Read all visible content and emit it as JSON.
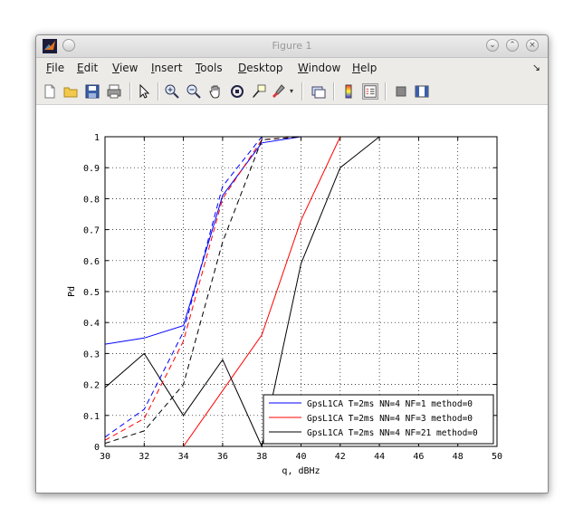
{
  "window": {
    "title": "Figure 1"
  },
  "menu": [
    {
      "label": "File",
      "u": "F",
      "rest": "ile"
    },
    {
      "label": "Edit",
      "u": "E",
      "rest": "dit"
    },
    {
      "label": "View",
      "u": "V",
      "rest": "iew"
    },
    {
      "label": "Insert",
      "u": "I",
      "rest": "nsert"
    },
    {
      "label": "Tools",
      "u": "T",
      "rest": "ools"
    },
    {
      "label": "Desktop",
      "u": "D",
      "rest": "esktop"
    },
    {
      "label": "Window",
      "u": "W",
      "rest": "indow"
    },
    {
      "label": "Help",
      "u": "H",
      "rest": "elp"
    }
  ],
  "toolbar_icons": [
    "new-figure-icon",
    "open-file-icon",
    "save-icon",
    "print-icon",
    "select-arrow-icon",
    "zoom-in-icon",
    "zoom-out-icon",
    "pan-hand-icon",
    "rotate-3d-icon",
    "data-cursor-icon",
    "brush-icon",
    "link-plot-icon",
    "insert-colorbar-icon",
    "insert-legend-icon",
    "hide-plot-tools-icon",
    "show-plot-tools-icon"
  ],
  "chart_data": {
    "type": "line",
    "xlabel": "q, dBHz",
    "ylabel": "Pd",
    "xlim": [
      30,
      50
    ],
    "ylim": [
      0,
      1
    ],
    "xticks": [
      30,
      32,
      34,
      36,
      38,
      40,
      42,
      44,
      46,
      48,
      50
    ],
    "yticks": [
      0,
      0.1,
      0.2,
      0.3,
      0.4,
      0.5,
      0.6,
      0.7,
      0.8,
      0.9,
      1
    ],
    "ytick_labels": [
      "0",
      "0.1",
      "0.2",
      "0.3",
      "0.4",
      "0.5",
      "0.6",
      "0.7",
      "0.8",
      "0.9",
      "1"
    ],
    "grid": "dotted",
    "legend_position": "bottom-right",
    "series": [
      {
        "name": "GpsL1CA T=2ms NN=4 NF=1 method=0",
        "color": "#0000ff",
        "style": "solid",
        "x": [
          30,
          32,
          34,
          36,
          38,
          40,
          42,
          44,
          46,
          48,
          50
        ],
        "y": [
          0.33,
          0.35,
          0.39,
          0.81,
          0.98,
          1,
          1,
          1,
          1,
          1,
          1
        ]
      },
      {
        "name": "GpsL1CA T=2ms NN=4 NF=3 method=0",
        "color": "#ff0000",
        "style": "solid",
        "x": [
          30,
          32,
          34,
          36,
          38,
          40,
          42,
          44,
          46,
          48,
          50
        ],
        "y": [
          0,
          0,
          0,
          0.18,
          0.36,
          0.73,
          1,
          1,
          1,
          1,
          1
        ]
      },
      {
        "name": "GpsL1CA T=2ms NN=4 NF=21 method=0",
        "color": "#000000",
        "style": "solid",
        "x": [
          30,
          32,
          34,
          36,
          38,
          40,
          42,
          44,
          46,
          48,
          50
        ],
        "y": [
          0.19,
          0.3,
          0.1,
          0.28,
          0,
          0.59,
          0.9,
          1,
          1,
          1,
          1
        ]
      },
      {
        "name": "",
        "color": "#0000ff",
        "style": "dashed",
        "x": [
          30,
          32,
          34,
          36,
          38,
          40,
          42,
          44,
          46,
          48,
          50
        ],
        "y": [
          0.03,
          0.12,
          0.37,
          0.84,
          1,
          1,
          1,
          1,
          1,
          1,
          1
        ]
      },
      {
        "name": "",
        "color": "#ff0000",
        "style": "dashed",
        "x": [
          30,
          32,
          34,
          36,
          38,
          40,
          42,
          44,
          46,
          48,
          50
        ],
        "y": [
          0.02,
          0.09,
          0.34,
          0.8,
          0.99,
          1,
          1,
          1,
          1,
          1,
          1
        ]
      },
      {
        "name": "",
        "color": "#000000",
        "style": "dashed",
        "x": [
          30,
          32,
          34,
          36,
          38,
          40,
          42,
          44,
          46,
          48,
          50
        ],
        "y": [
          0.01,
          0.05,
          0.2,
          0.66,
          0.99,
          1,
          1,
          1,
          1,
          1,
          1
        ]
      }
    ]
  }
}
